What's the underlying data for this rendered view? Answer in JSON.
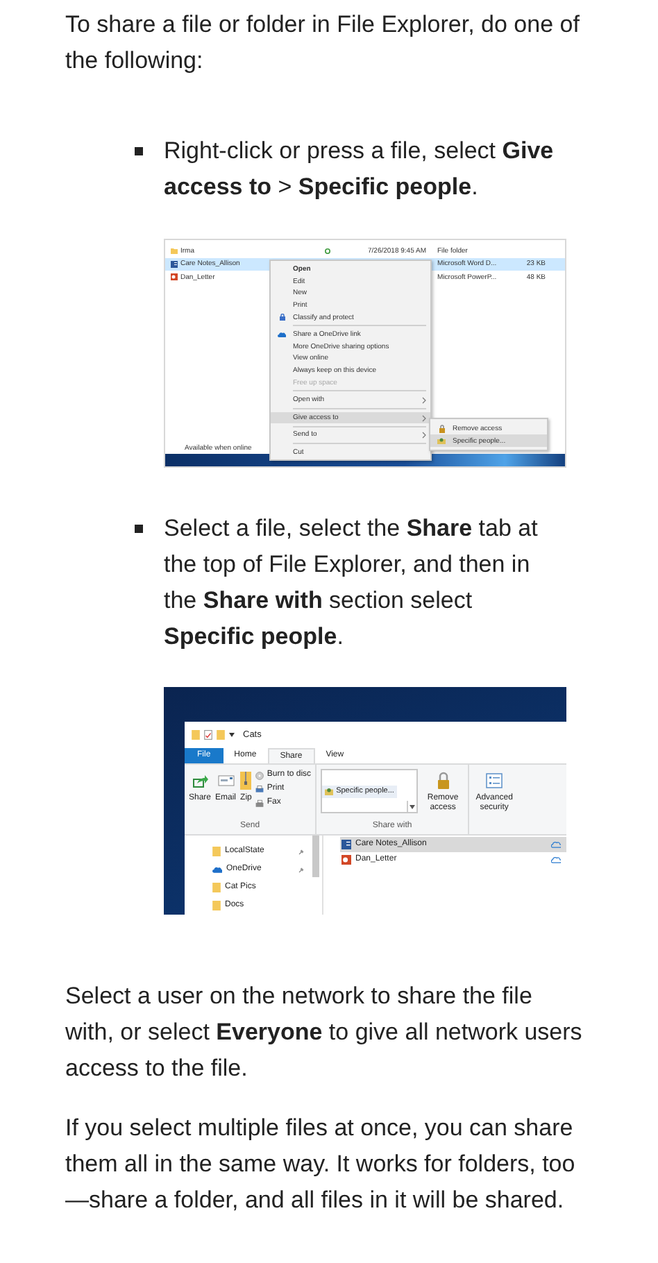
{
  "intro": "To share a file or folder in File Explorer, do one of the following:",
  "steps": [
    {
      "text": "Right-click or press a file, select **Give access to** > **Specific people**.",
      "screenshot": {
        "files": [
          {
            "kind": "folder",
            "name": "Irma",
            "synced": true,
            "date": "7/26/2018 9:45 AM",
            "type": "File folder",
            "selected": false
          },
          {
            "kind": "word",
            "name": "Care Notes_Allison",
            "type": "Microsoft Word D...",
            "size": "23 KB",
            "selected": true
          },
          {
            "kind": "powerpoint",
            "name": "Dan_Letter",
            "type": "Microsoft PowerP...",
            "size": "48 KB",
            "selected": false
          }
        ],
        "context_menu": [
          {
            "kind": "default",
            "label": "Open",
            "disabled": false,
            "selected": false,
            "submenu": false
          },
          {
            "kind": "plain",
            "label": "Edit",
            "disabled": false,
            "selected": false,
            "submenu": false
          },
          {
            "kind": "plain",
            "label": "New",
            "disabled": false,
            "selected": false,
            "submenu": false
          },
          {
            "kind": "plain",
            "label": "Print",
            "disabled": false,
            "selected": false,
            "submenu": false
          },
          {
            "kind": "protect",
            "label": "Classify and protect",
            "disabled": false,
            "selected": false,
            "submenu": false
          },
          {
            "kind": "separator"
          },
          {
            "kind": "onedrive",
            "label": "Share a OneDrive link",
            "disabled": false,
            "selected": false,
            "submenu": false
          },
          {
            "kind": "plain",
            "label": "More OneDrive sharing options",
            "disabled": false,
            "selected": false,
            "submenu": false
          },
          {
            "kind": "plain",
            "label": "View online",
            "disabled": false,
            "selected": false,
            "submenu": false
          },
          {
            "kind": "plain",
            "label": "Always keep on this device",
            "disabled": false,
            "selected": false,
            "submenu": false
          },
          {
            "kind": "plain",
            "label": "Free up space",
            "disabled": true,
            "selected": false,
            "submenu": false
          },
          {
            "kind": "separator"
          },
          {
            "kind": "plain",
            "label": "Open with",
            "disabled": false,
            "selected": false,
            "submenu": true
          },
          {
            "kind": "separator"
          },
          {
            "kind": "plain",
            "label": "Give access to",
            "disabled": false,
            "selected": true,
            "submenu": true
          },
          {
            "kind": "separator"
          },
          {
            "kind": "plain",
            "label": "Send to",
            "disabled": false,
            "selected": false,
            "submenu": true
          },
          {
            "kind": "separator"
          },
          {
            "kind": "plain",
            "label": "Cut",
            "disabled": false,
            "selected": false,
            "submenu": false
          }
        ],
        "submenu": [
          {
            "kind": "lock",
            "label": "Remove access",
            "selected": false
          },
          {
            "kind": "people",
            "label": "Specific people...",
            "selected": true
          }
        ],
        "status_text": "Available when online"
      }
    },
    {
      "text": "Select a file, select the **Share** tab at the top of File Explorer, and then in the **Share with** section select **Specific people**.",
      "screenshot": {
        "title": "Cats",
        "tabs": [
          {
            "kind": "file",
            "label": "File",
            "selected": false
          },
          {
            "kind": "tab",
            "label": "Home",
            "selected": false
          },
          {
            "kind": "tab",
            "label": "Share",
            "selected": true
          },
          {
            "kind": "tab",
            "label": "View",
            "selected": false
          }
        ],
        "send_group": {
          "label": "Send",
          "large_buttons": [
            {
              "kind": "share",
              "label": "Share"
            },
            {
              "kind": "email",
              "label": "Email"
            },
            {
              "kind": "zip",
              "label": "Zip"
            }
          ],
          "small_buttons": [
            {
              "kind": "disc",
              "label": "Burn to disc"
            },
            {
              "kind": "print",
              "label": "Print"
            },
            {
              "kind": "fax",
              "label": "Fax"
            }
          ]
        },
        "share_with_group": {
          "label": "Share with",
          "list_items": [
            "Specific people..."
          ],
          "buttons": [
            {
              "kind": "lock",
              "label": "Remove access"
            }
          ]
        },
        "security_button": {
          "kind": "security",
          "label": "Advanced security"
        },
        "nav_items": [
          {
            "kind": "folder",
            "label": "LocalState",
            "pinned": true
          },
          {
            "kind": "onedrive",
            "label": "OneDrive",
            "pinned": true
          },
          {
            "kind": "folder",
            "label": "Cat Pics",
            "pinned": false
          },
          {
            "kind": "folder",
            "label": "Docs",
            "pinned": false
          }
        ],
        "files": [
          {
            "kind": "word",
            "name": "Care Notes_Allison",
            "selected": true
          },
          {
            "kind": "powerpoint",
            "name": "Dan_Letter",
            "selected": false
          }
        ]
      }
    }
  ],
  "paragraphs": [
    "Select a user on the network to share the file with, or select **Everyone** to give all network users access to the file.",
    "If you select multiple files at once, you can share them all in the same way. It works for folders, too—share a folder, and all files in it will be shared."
  ]
}
